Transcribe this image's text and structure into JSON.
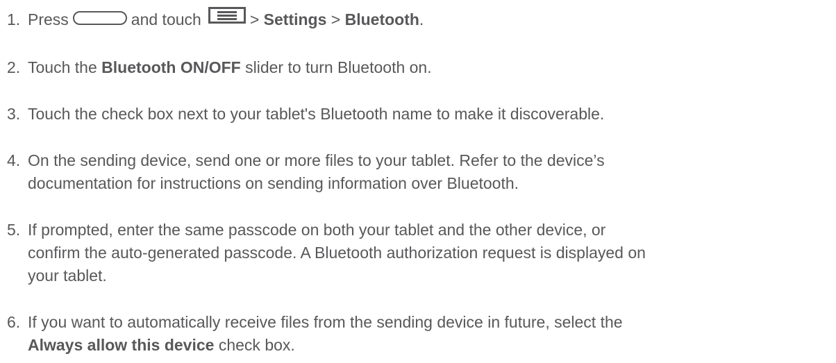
{
  "steps": [
    {
      "number": "1.",
      "prefix": "Press",
      "mid": "and touch",
      "sep1": ">",
      "bold1": "Settings",
      "sep2": ">",
      "bold2": "Bluetooth",
      "end": "."
    },
    {
      "number": "2.",
      "before": "Touch the",
      "bold": "Bluetooth ON/OFF",
      "after": "slider to turn Bluetooth on."
    },
    {
      "number": "3.",
      "text": "Touch the check box next to your tablet's Bluetooth name to make it discoverable."
    },
    {
      "number": "4.",
      "line1": "On the sending device, send one or more files to your tablet. Refer to the device’s",
      "line2": "documentation for instructions on sending information over Bluetooth."
    },
    {
      "number": "5.",
      "line1": "If prompted, enter the same passcode on both your tablet and the other device, or",
      "line2": "confirm the auto-generated passcode. A Bluetooth authorization request is displayed on",
      "line3": "your tablet."
    },
    {
      "number": "6.",
      "line1": "If you want to automatically receive files from the sending device in future, select the",
      "bold": "Always allow this device",
      "after": "check box."
    }
  ],
  "icons": {
    "home_key": "home-key-icon",
    "menu_key": "menu-key-icon",
    "color": "#58585a"
  }
}
